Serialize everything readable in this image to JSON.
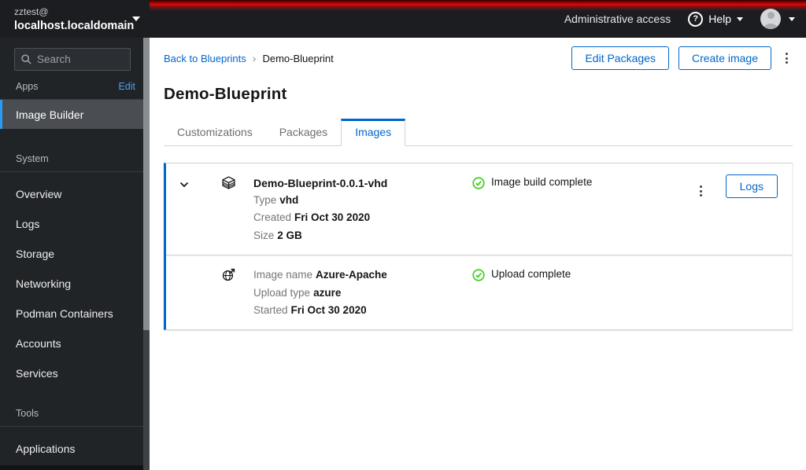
{
  "host_switcher": {
    "user": "zztest@",
    "host": "localhost.localdomain"
  },
  "masthead": {
    "admin_access": "Administrative access",
    "help_label": "Help"
  },
  "sidebar": {
    "search_placeholder": "Search",
    "sections": [
      {
        "title": "Apps",
        "action": "Edit",
        "items": [
          {
            "label": "Image Builder",
            "selected": true
          }
        ]
      },
      {
        "title": "System",
        "items": [
          {
            "label": "Overview"
          },
          {
            "label": "Logs"
          },
          {
            "label": "Storage"
          },
          {
            "label": "Networking"
          },
          {
            "label": "Podman Containers"
          },
          {
            "label": "Accounts"
          },
          {
            "label": "Services"
          }
        ]
      },
      {
        "title": "Tools",
        "items": [
          {
            "label": "Applications"
          }
        ]
      }
    ]
  },
  "breadcrumb": {
    "back": "Back to Blueprints",
    "separator": "›",
    "current": "Demo-Blueprint"
  },
  "page": {
    "title": "Demo-Blueprint"
  },
  "actions": {
    "edit_packages": "Edit Packages",
    "create_image": "Create image"
  },
  "tabs": [
    {
      "label": "Customizations"
    },
    {
      "label": "Packages"
    },
    {
      "label": "Images",
      "active": true
    }
  ],
  "images": [
    {
      "name": "Demo-Blueprint-0.0.1-vhd",
      "details": [
        {
          "label": "Type",
          "value": "vhd"
        },
        {
          "label": "Created",
          "value": "Fri Oct 30 2020"
        },
        {
          "label": "Size",
          "value": "2 GB"
        }
      ],
      "status": "Image build complete",
      "logs_label": "Logs"
    },
    {
      "details": [
        {
          "label": "Image name",
          "value": "Azure-Apache"
        },
        {
          "label": "Upload type",
          "value": "azure"
        },
        {
          "label": "Started",
          "value": "Fri Oct 30 2020"
        }
      ],
      "status": "Upload complete"
    }
  ],
  "colors": {
    "accent": "#0066cc",
    "success": "#4ed02c",
    "nav_selected_border": "#2b9af3",
    "masthead_red": "#e40808"
  }
}
